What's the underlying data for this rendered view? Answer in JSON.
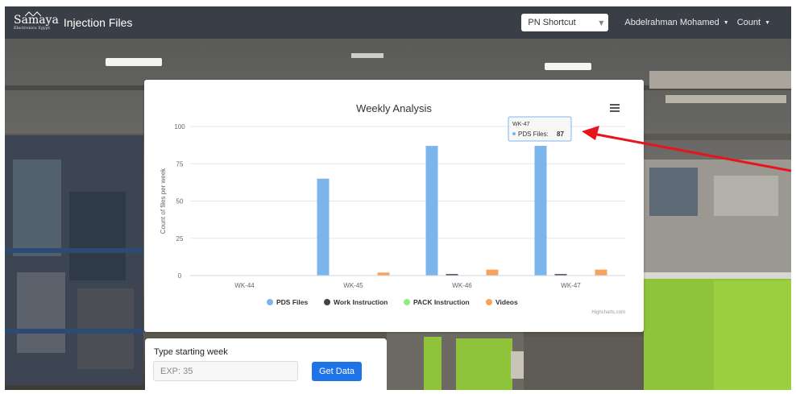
{
  "navbar": {
    "logo_name": "Samaya",
    "logo_sub": "Electronics Egypt",
    "title": "Injection Files",
    "pn_shortcut": "PN Shortcut",
    "user": "Abdelrahman Mohamed",
    "count": "Count"
  },
  "form": {
    "label": "Type starting week",
    "placeholder": "EXP: 35",
    "button": "Get Data"
  },
  "chart_data": {
    "type": "bar",
    "title": "Weekly Analysis",
    "ylabel": "Count of files per week",
    "xlabel": "",
    "ylim": [
      0,
      100
    ],
    "yticks": [
      0,
      25,
      50,
      75,
      100
    ],
    "categories": [
      "WK-44",
      "WK-45",
      "WK-46",
      "WK-47"
    ],
    "series": [
      {
        "name": "PDS Files",
        "color": "#7cb5ec",
        "values": [
          0,
          65,
          87,
          87
        ]
      },
      {
        "name": "Work Instruction",
        "color": "#434348",
        "values": [
          0,
          0,
          1,
          1
        ]
      },
      {
        "name": "PACK Instruction",
        "color": "#90ed7d",
        "values": [
          0,
          0,
          0,
          0
        ]
      },
      {
        "name": "Videos",
        "color": "#f7a35c",
        "values": [
          0,
          2,
          4,
          4
        ]
      }
    ],
    "legend": "bottom",
    "grid": true,
    "credits": "Highcharts.com",
    "tooltip": {
      "category": "WK-47",
      "series": "PDS Files",
      "value": 87
    }
  },
  "colors": {
    "navbar": "#3a3f47",
    "button": "#1e73e8",
    "arrow": "#e8141b"
  }
}
